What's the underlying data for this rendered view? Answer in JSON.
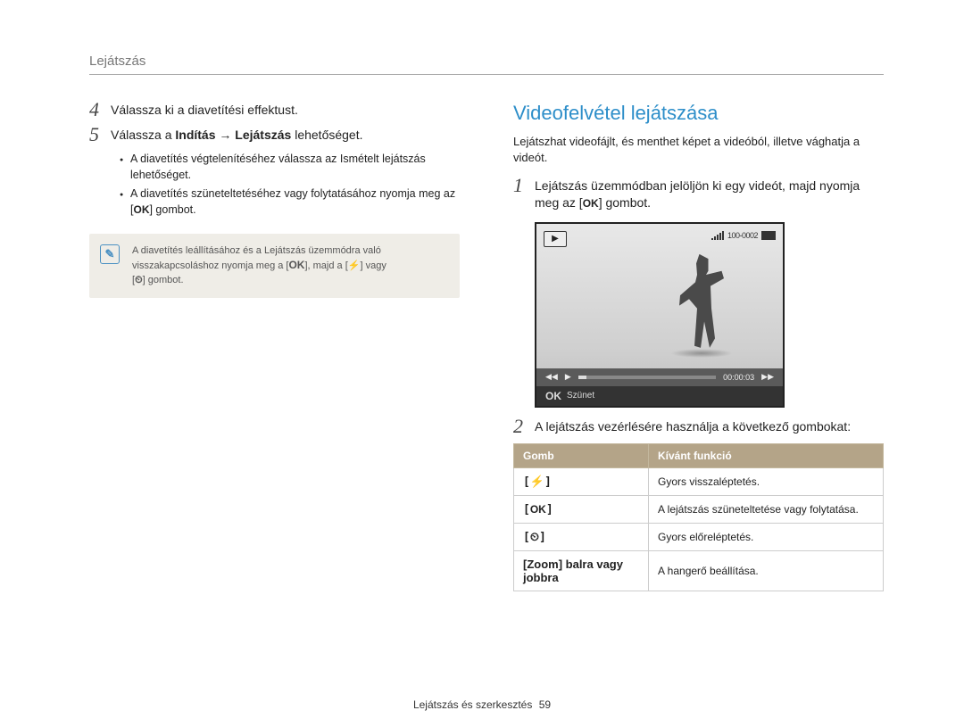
{
  "header": {
    "title": "Lejátszás"
  },
  "left": {
    "step4": {
      "num": "4",
      "text": "Válassza ki a diavetítési effektust."
    },
    "step5": {
      "num": "5",
      "text_pre": "Válassza a ",
      "bold1": "Indítás",
      "arrow": " → ",
      "bold2": "Lejátszás",
      "text_post": " lehetőséget."
    },
    "sub": {
      "i1_pre": "A diavetítés végtelenítéséhez válassza az ",
      "i1_bold": "Ismételt lejátszás",
      "i1_post": " lehetőséget.",
      "i2_pre": "A diavetítés szüneteltetéséhez vagy folytatásához nyomja meg az [",
      "i2_ok": "OK",
      "i2_post": "] gombot."
    },
    "note": {
      "line1_pre": "A diavetítés leállításához és a Lejátszás üzemmódra való",
      "line2_pre": "visszakapcsoláshoz nyomja meg a [",
      "ok": "OK",
      "mid": "], majd a [",
      "flash": "⚡",
      "or": "] vagy",
      "line3_pre": "[",
      "timer": "⏲",
      "line3_post": "] gombot."
    }
  },
  "right": {
    "title": "Videofelvétel lejátszása",
    "intro": "Lejátszhat videofájlt, és menthet képet a videóból, illetve vághatja a videót.",
    "step1": {
      "num": "1",
      "line1": "Lejátszás üzemmódban jelöljön ki egy videót, majd nyomja",
      "line2_pre": "meg az [",
      "ok": "OK",
      "line2_post": "] gombot."
    },
    "screenshot": {
      "top_counter": "100-0002",
      "time": "00:00:03",
      "bottom_ok": "OK",
      "bottom_label": "Szünet"
    },
    "step2": {
      "num": "2",
      "text": "A lejátszás vezérlésére használja a következő gombokat:"
    },
    "table": {
      "h1": "Gomb",
      "h2": "Kívánt funkció",
      "rows": [
        {
          "btn_pre": "[",
          "btn_sym": "⚡",
          "btn_post": "]",
          "func": "Gyors visszaléptetés."
        },
        {
          "btn_pre": "[",
          "btn_sym": "OK",
          "btn_post": "]",
          "func": "A lejátszás szüneteltetése vagy folytatása."
        },
        {
          "btn_pre": "[",
          "btn_sym": "⏲",
          "btn_post": "]",
          "func": "Gyors előreléptetés."
        },
        {
          "btn_plain": "[Zoom] balra vagy jobbra",
          "func": "A hangerő beállítása."
        }
      ]
    }
  },
  "footer": {
    "text": "Lejátszás és szerkesztés",
    "page": "59"
  }
}
